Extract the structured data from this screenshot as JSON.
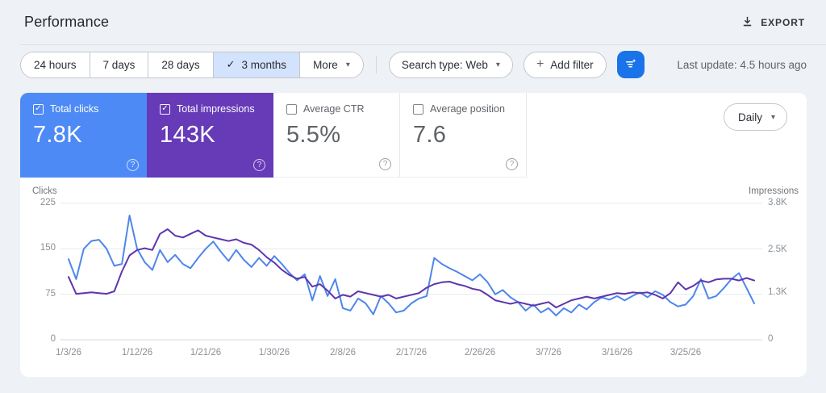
{
  "header": {
    "title": "Performance",
    "export_label": "EXPORT"
  },
  "toolbar": {
    "ranges": [
      {
        "label": "24 hours",
        "selected": false
      },
      {
        "label": "7 days",
        "selected": false
      },
      {
        "label": "28 days",
        "selected": false
      },
      {
        "label": "3 months",
        "selected": true
      }
    ],
    "more_label": "More",
    "search_type_label": "Search type: Web",
    "add_filter_label": "Add filter",
    "last_update": "Last update: 4.5 hours ago"
  },
  "cards": [
    {
      "label": "Total clicks",
      "value": "7.8K",
      "checked": true,
      "bg": "#4d8af5"
    },
    {
      "label": "Total impressions",
      "value": "143K",
      "checked": true,
      "bg": "#673ab7"
    },
    {
      "label": "Average CTR",
      "value": "5.5%",
      "checked": false
    },
    {
      "label": "Average position",
      "value": "7.6",
      "checked": false
    }
  ],
  "granularity": "Daily",
  "glyphs": {
    "check": "✓",
    "caret": "▾",
    "plus": "+",
    "help": "?"
  },
  "colors": {
    "accent_blue": "#1a73e8",
    "card_blue": "#4d8af5",
    "card_purple": "#673ab7",
    "selected_chip_bg": "#d3e3fd",
    "line_clicks": "#4e86ec",
    "line_impressions": "#5e35ad"
  },
  "chart_data": {
    "type": "line",
    "grid": true,
    "legend_position": "none",
    "x_tick_labels": [
      "1/3/26",
      "1/12/26",
      "1/21/26",
      "1/30/26",
      "2/8/26",
      "2/17/26",
      "2/26/26",
      "3/7/26",
      "3/16/26",
      "3/25/26"
    ],
    "x_tick_days": [
      0,
      9,
      18,
      27,
      36,
      45,
      54,
      63,
      72,
      81
    ],
    "x_range_days": 91,
    "left_axis": {
      "label": "Clicks",
      "max": 225,
      "ticks": [
        {
          "label": "0",
          "value": 0
        },
        {
          "label": "75",
          "value": 75
        },
        {
          "label": "150",
          "value": 150
        },
        {
          "label": "225",
          "value": 225
        }
      ]
    },
    "right_axis": {
      "label": "Impressions",
      "max": 3800,
      "ticks": [
        {
          "label": "0",
          "value": 0
        },
        {
          "label": "1.3K",
          "value": 1300
        },
        {
          "label": "2.5K",
          "value": 2500
        },
        {
          "label": "3.8K",
          "value": 3800
        }
      ]
    },
    "series": [
      {
        "name": "Total clicks",
        "axis": "left",
        "color": "#4e86ec",
        "values": [
          133,
          100,
          150,
          163,
          165,
          150,
          122,
          125,
          205,
          150,
          128,
          115,
          148,
          128,
          140,
          125,
          118,
          135,
          150,
          162,
          145,
          130,
          148,
          132,
          120,
          135,
          122,
          138,
          125,
          110,
          98,
          108,
          65,
          105,
          72,
          100,
          52,
          48,
          68,
          60,
          42,
          72,
          60,
          45,
          48,
          60,
          68,
          72,
          135,
          125,
          118,
          112,
          105,
          98,
          108,
          95,
          75,
          82,
          70,
          62,
          48,
          58,
          45,
          52,
          40,
          52,
          45,
          58,
          50,
          62,
          70,
          66,
          72,
          65,
          72,
          78,
          70,
          80,
          74,
          62,
          55,
          58,
          72,
          100,
          68,
          72,
          85,
          100,
          110,
          85,
          60
        ]
      },
      {
        "name": "Total impressions",
        "axis": "right",
        "color": "#5e35ad",
        "values": [
          1750,
          1280,
          1300,
          1320,
          1300,
          1280,
          1350,
          1900,
          2350,
          2500,
          2550,
          2500,
          2950,
          3080,
          2900,
          2850,
          2950,
          3050,
          2900,
          2850,
          2800,
          2750,
          2800,
          2700,
          2650,
          2500,
          2300,
          2150,
          1950,
          1800,
          1700,
          1750,
          1480,
          1550,
          1370,
          1150,
          1250,
          1200,
          1350,
          1300,
          1250,
          1200,
          1250,
          1150,
          1200,
          1250,
          1300,
          1450,
          1550,
          1600,
          1620,
          1550,
          1500,
          1420,
          1380,
          1250,
          1100,
          1050,
          1000,
          1050,
          1000,
          950,
          1000,
          1050,
          900,
          1000,
          1100,
          1150,
          1200,
          1150,
          1200,
          1250,
          1300,
          1280,
          1320,
          1300,
          1320,
          1250,
          1150,
          1300,
          1600,
          1400,
          1500,
          1650,
          1600,
          1680,
          1700,
          1700,
          1650,
          1720,
          1650
        ]
      }
    ]
  }
}
